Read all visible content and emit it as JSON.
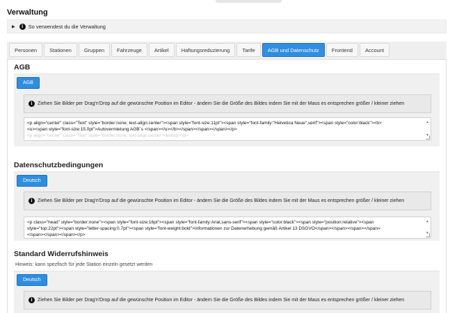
{
  "page": {
    "title": "Verwaltung"
  },
  "info": {
    "label": "So verwendest du die Verwaltung"
  },
  "tabs": [
    {
      "label": "Personen"
    },
    {
      "label": "Stationen"
    },
    {
      "label": "Gruppen"
    },
    {
      "label": "Fahrzeuge"
    },
    {
      "label": "Artikel"
    },
    {
      "label": "Haftungsreduzierung"
    },
    {
      "label": "Tarife"
    },
    {
      "label": "AGB und Datenschutz",
      "active": true
    },
    {
      "label": "Frontend"
    },
    {
      "label": "Account"
    }
  ],
  "hint_text": "Ziehen Sie Bilder per Drag'n'Drop auf die gewünschte Position im Editor - ändern Sie die Größe des Bildes indem Sie mit der Maus es entsprechen größer / kleiner ziehen",
  "sections": {
    "agb": {
      "title": "AGB",
      "lang_tab": "AGB",
      "code_line1": "<p align=\"center\" class=\"Text\" style=\"border:none; text-align:center\"><span style=\"font-size:11pt\"><span style=\"font-family:\"Helvetica Neue\",serif\"><span style=\"color:black\"><b>",
      "code_line2": "<u><span style=\"font-size:15.0pt\">Autovermietung AGB´s </span></u></b></span></span></span></p>",
      "code_line3": "<p align=\"center\" class=\"Text\" style=\"border:none; text-align:center\">&nbsp;</p>"
    },
    "privacy": {
      "title": "Datenschutzbedingungen",
      "lang_tab": "Deutsch",
      "code_line1": "<p class=\"head\" style=\"border:none\"><span style=\"font-size:16pt\"><span style=\"font-family:Arial,sans-serif\"><span style=\"color:black\"><span style=\"position:relative\"><span",
      "code_line2": "style=\"top:22pt\"><span style=\"letter-spacing:0.7pt\"><span style=\"font-weight:bold\">Informationen zur Datenerhebung gemäß Artikel 13 DSGVO</span></span></span></span>",
      "code_line3": "</span></span></span></p>"
    },
    "withdrawal": {
      "title": "Standard Widerrufshinweis",
      "hint": "Hinweis: kann spezfisch für jede Station einzeln gesetzt werden",
      "lang_tab": "Deutsch"
    }
  },
  "colors": {
    "accent": "#2f8ee0",
    "panel_bg": "#f0f0f0"
  },
  "icons": {
    "info": "info-circle-icon",
    "caret": "caret-right-icon"
  }
}
